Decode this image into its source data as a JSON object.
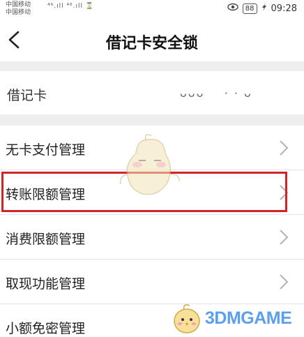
{
  "status_bar": {
    "carrier_1": "中国移动",
    "carrier_2": "中国移动",
    "signal_text": "⁴⁶.ıll ⁴⁶.ıll ⌛",
    "battery": "88",
    "time": "09:28"
  },
  "nav": {
    "back_icon": "chevron-left-icon",
    "title": "借记卡安全锁"
  },
  "card": {
    "label": "借记卡",
    "number": "ᴗᴗᴗ    · · ᴗ"
  },
  "menu": [
    {
      "name": "menu-item-cardless-payment",
      "label": "无卡支付管理"
    },
    {
      "name": "menu-item-transfer-limit",
      "label": "转账限额管理"
    },
    {
      "name": "menu-item-consumption-limit",
      "label": "消费限额管理"
    },
    {
      "name": "menu-item-cash-withdrawal",
      "label": "取现功能管理"
    },
    {
      "name": "menu-item-small-password-free",
      "label": "小额免密管理"
    }
  ],
  "watermark": {
    "text": "3DMGAME"
  },
  "colors": {
    "highlight": "#d2222a",
    "watermark": "#5aa0ee",
    "separator": "#eeeeee"
  }
}
